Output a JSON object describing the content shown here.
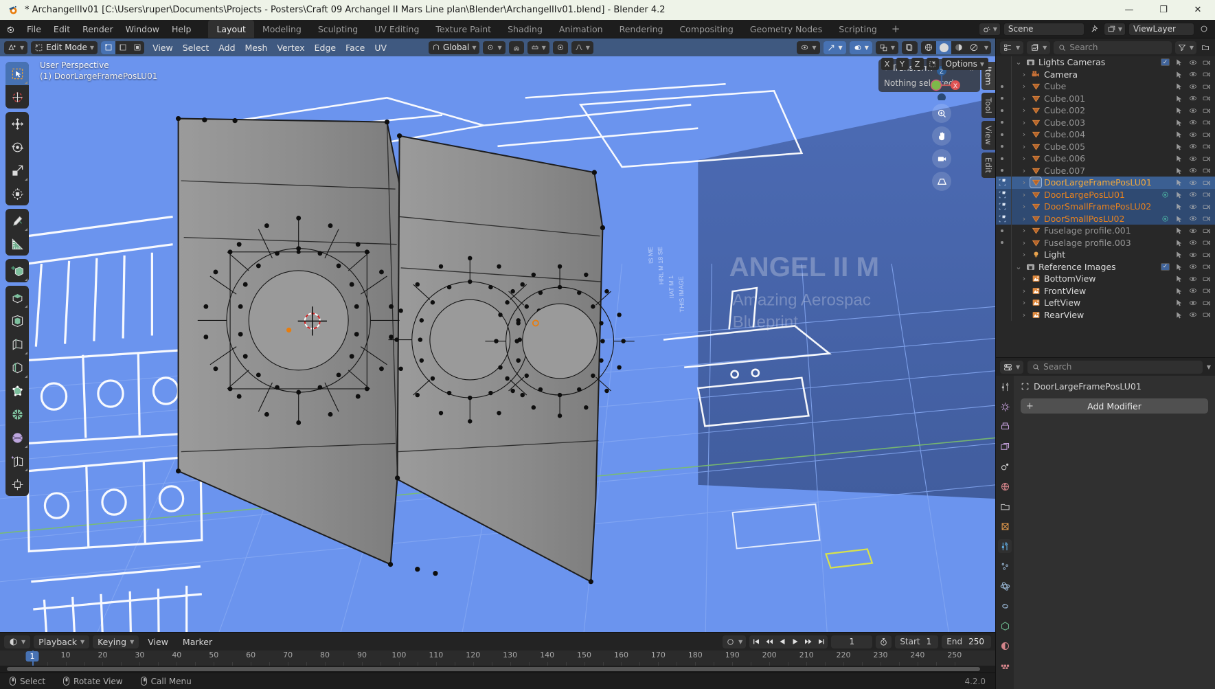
{
  "window": {
    "title": "* ArchangelIIv01 [C:\\Users\\ruper\\Documents\\Projects - Posters\\Craft 09 Archangel II Mars Line plan\\Blender\\ArchangelIIv01.blend] - Blender 4.2",
    "minimize": "—",
    "maximize": "❐",
    "close": "✕"
  },
  "topbar": {
    "menus": [
      "File",
      "Edit",
      "Render",
      "Window",
      "Help"
    ],
    "workspaces": [
      {
        "label": "Layout",
        "active": true
      },
      {
        "label": "Modeling",
        "active": false
      },
      {
        "label": "Sculpting",
        "active": false
      },
      {
        "label": "UV Editing",
        "active": false
      },
      {
        "label": "Texture Paint",
        "active": false
      },
      {
        "label": "Shading",
        "active": false
      },
      {
        "label": "Animation",
        "active": false
      },
      {
        "label": "Rendering",
        "active": false
      },
      {
        "label": "Compositing",
        "active": false
      },
      {
        "label": "Geometry Nodes",
        "active": false
      },
      {
        "label": "Scripting",
        "active": false
      },
      {
        "label": "+",
        "active": false
      }
    ],
    "scene_name": "Scene",
    "view_layer_name": "ViewLayer"
  },
  "viewport": {
    "mode": "Edit Mode",
    "menus": [
      "View",
      "Select",
      "Add",
      "Mesh",
      "Vertex",
      "Edge",
      "Face",
      "UV"
    ],
    "orientation": "Global",
    "overlay_line1": "User Perspective",
    "overlay_line2": "(1) DoorLargeFramePosLU01",
    "axis_buttons": [
      "X",
      "Y",
      "Z"
    ],
    "options_label": "Options",
    "gizmo_axes": {
      "z": "Z",
      "x": "X"
    },
    "side_tabs": [
      {
        "label": "Item",
        "active": true
      },
      {
        "label": "Tool",
        "active": false
      },
      {
        "label": "View",
        "active": false
      },
      {
        "label": "Edit",
        "active": false
      }
    ],
    "npanel": {
      "title": "Transform",
      "body": "Nothing selected"
    },
    "tools": [
      {
        "name": "tweak-select-tool",
        "active": true
      },
      {
        "name": "cursor-tool",
        "active": false
      },
      {
        "name": "move-tool",
        "active": false
      },
      {
        "name": "rotate-tool",
        "active": false
      },
      {
        "name": "scale-tool",
        "active": false
      },
      {
        "name": "transform-tool",
        "active": false
      },
      {
        "name": "annotate-tool",
        "active": false
      },
      {
        "name": "measure-tool",
        "active": false
      },
      {
        "name": "add-cube-tool",
        "active": false
      },
      {
        "name": "extrude-region-tool",
        "active": false
      },
      {
        "name": "inset-faces-tool",
        "active": false
      },
      {
        "name": "bevel-tool",
        "active": false
      },
      {
        "name": "loop-cut-tool",
        "active": false
      },
      {
        "name": "knife-tool",
        "active": false
      },
      {
        "name": "poly-build-tool",
        "active": false
      },
      {
        "name": "spin-tool",
        "active": false
      },
      {
        "name": "smooth-tool",
        "active": false
      },
      {
        "name": "shrink-fatten-tool",
        "active": false
      },
      {
        "name": "shear-tool",
        "active": false
      },
      {
        "name": "rip-region-tool",
        "active": false
      }
    ]
  },
  "outliner": {
    "search_placeholder": "Search",
    "items": [
      {
        "label": "Lights Cameras",
        "type": "collection",
        "indent": 0,
        "state": "open",
        "sel": false,
        "active": false,
        "color": "white",
        "checkbox": true
      },
      {
        "label": "Camera",
        "type": "camera",
        "indent": 1,
        "state": "closed",
        "sel": false,
        "active": false,
        "color": "white"
      },
      {
        "label": "Cube",
        "type": "mesh",
        "indent": 1,
        "state": "closed",
        "sel": false,
        "active": false,
        "color": "dim"
      },
      {
        "label": "Cube.001",
        "type": "mesh",
        "indent": 1,
        "state": "closed",
        "sel": false,
        "active": false,
        "color": "dim"
      },
      {
        "label": "Cube.002",
        "type": "mesh",
        "indent": 1,
        "state": "closed",
        "sel": false,
        "active": false,
        "color": "dim"
      },
      {
        "label": "Cube.003",
        "type": "mesh",
        "indent": 1,
        "state": "closed",
        "sel": false,
        "active": false,
        "color": "dim"
      },
      {
        "label": "Cube.004",
        "type": "mesh",
        "indent": 1,
        "state": "closed",
        "sel": false,
        "active": false,
        "color": "dim"
      },
      {
        "label": "Cube.005",
        "type": "mesh",
        "indent": 1,
        "state": "closed",
        "sel": false,
        "active": false,
        "color": "dim"
      },
      {
        "label": "Cube.006",
        "type": "mesh",
        "indent": 1,
        "state": "closed",
        "sel": false,
        "active": false,
        "color": "dim"
      },
      {
        "label": "Cube.007",
        "type": "mesh",
        "indent": 1,
        "state": "closed",
        "sel": false,
        "active": false,
        "color": "dim"
      },
      {
        "label": "DoorLargeFramePosLU01",
        "type": "mesh",
        "indent": 1,
        "state": "closed",
        "sel": true,
        "active": true,
        "color": "yellow",
        "edit": true
      },
      {
        "label": "DoorLargePosLU01",
        "type": "mesh",
        "indent": 1,
        "state": "closed",
        "sel": true,
        "active": false,
        "color": "orange",
        "edit": true,
        "material": true
      },
      {
        "label": "DoorSmallFramePosLU02",
        "type": "mesh",
        "indent": 1,
        "state": "closed",
        "sel": true,
        "active": false,
        "color": "orange",
        "edit": true
      },
      {
        "label": "DoorSmallPosLU02",
        "type": "mesh",
        "indent": 1,
        "state": "closed",
        "sel": true,
        "active": false,
        "color": "orange",
        "edit": true,
        "material": true
      },
      {
        "label": "Fuselage profile.001",
        "type": "mesh",
        "indent": 1,
        "state": "closed",
        "sel": false,
        "active": false,
        "color": "dim"
      },
      {
        "label": "Fuselage profile.003",
        "type": "mesh",
        "indent": 1,
        "state": "closed",
        "sel": false,
        "active": false,
        "color": "dim"
      },
      {
        "label": "Light",
        "type": "light",
        "indent": 1,
        "state": "closed",
        "sel": false,
        "active": false,
        "color": "white"
      },
      {
        "label": "Reference Images",
        "type": "collection",
        "indent": 0,
        "state": "open",
        "sel": false,
        "active": false,
        "color": "white",
        "checkbox": true
      },
      {
        "label": "BottomView",
        "type": "image",
        "indent": 1,
        "state": "closed",
        "sel": false,
        "active": false,
        "color": "white"
      },
      {
        "label": "FrontView",
        "type": "image",
        "indent": 1,
        "state": "closed",
        "sel": false,
        "active": false,
        "color": "white"
      },
      {
        "label": "LeftView",
        "type": "image",
        "indent": 1,
        "state": "closed",
        "sel": false,
        "active": false,
        "color": "white"
      },
      {
        "label": "RearView",
        "type": "image",
        "indent": 1,
        "state": "closed",
        "sel": false,
        "active": false,
        "color": "white"
      }
    ]
  },
  "properties": {
    "search_placeholder": "Search",
    "object_name": "DoorLargeFramePosLU01",
    "add_modifier_label": "Add Modifier",
    "add_modifier_plus": "+"
  },
  "timeline": {
    "playback_label": "Playback",
    "keying_label": "Keying",
    "view_label": "View",
    "marker_label": "Marker",
    "current_frame": "1",
    "start_label": "Start",
    "start_value": "1",
    "end_label": "End",
    "end_value": "250",
    "playhead_frame": "1",
    "ticks": [
      10,
      20,
      30,
      40,
      50,
      60,
      70,
      80,
      90,
      100,
      110,
      120,
      130,
      140,
      150,
      160,
      170,
      180,
      190,
      200,
      210,
      220,
      230,
      240,
      250
    ]
  },
  "status": {
    "select": "Select",
    "rotate_view": "Rotate View",
    "call_menu": "Call Menu",
    "version": "4.2.0"
  },
  "colors": {
    "accent": "#4772b3",
    "viewport_blue": "#6b94ee",
    "selected_orange": "#e8821e",
    "active_yellow": "#f3a93c",
    "header_blue": "#3f5980"
  }
}
